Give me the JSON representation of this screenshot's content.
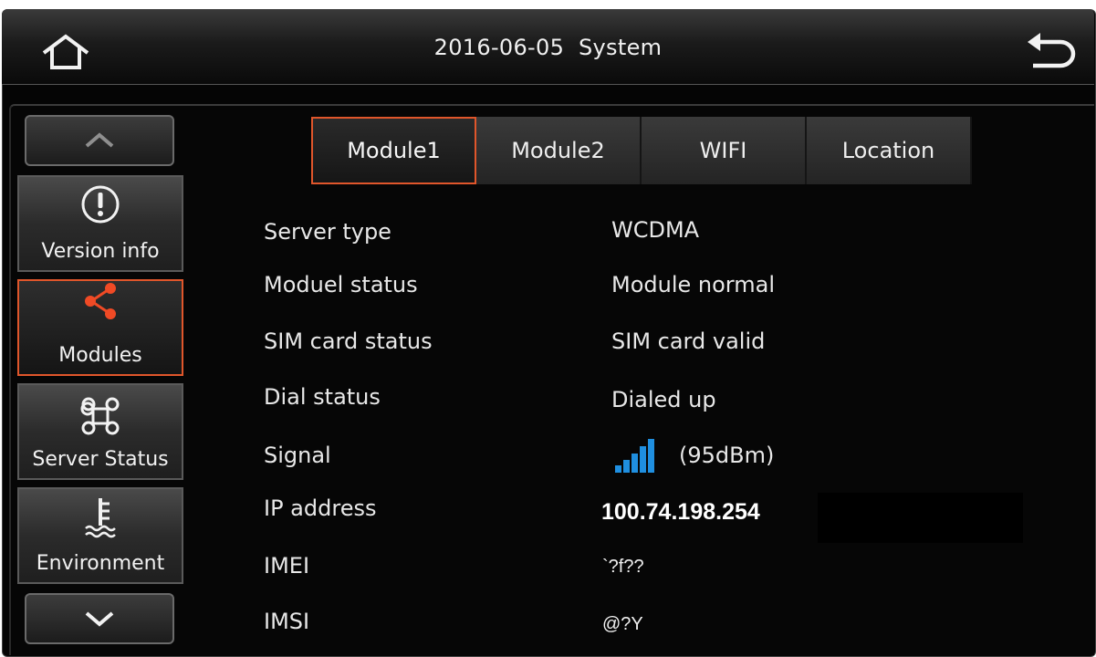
{
  "header": {
    "date": "2016-06-05",
    "title": "System"
  },
  "sidebar": {
    "items": [
      {
        "label": "Version info",
        "icon": "info-circle-icon",
        "active": false
      },
      {
        "label": "Modules",
        "icon": "share-icon",
        "active": true
      },
      {
        "label": "Server Status",
        "icon": "command-icon",
        "active": false
      },
      {
        "label": "Environment",
        "icon": "temperature-icon",
        "active": false
      }
    ]
  },
  "tabs": [
    {
      "label": "Module1",
      "active": true
    },
    {
      "label": "Module2",
      "active": false
    },
    {
      "label": "WIFI",
      "active": false
    },
    {
      "label": "Location",
      "active": false
    }
  ],
  "rows": {
    "server_type": {
      "label": "Server type",
      "value": "WCDMA"
    },
    "module_status": {
      "label": "Moduel status",
      "value": "Module normal"
    },
    "sim_status": {
      "label": "SIM card status",
      "value": "SIM card valid"
    },
    "dial_status": {
      "label": "Dial status",
      "value": "Dialed up"
    },
    "signal": {
      "label": "Signal",
      "value": "(95dBm)",
      "bars": 5
    },
    "ip_address": {
      "label": "IP address",
      "value": "100.74.198.254"
    },
    "imei": {
      "label": "IMEI",
      "value": "`?f??"
    },
    "imsi": {
      "label": "IMSI",
      "value": "@?Y"
    }
  },
  "colors": {
    "accent": "#e0562b",
    "signal": "#1f8fe0",
    "background": "#050505"
  }
}
